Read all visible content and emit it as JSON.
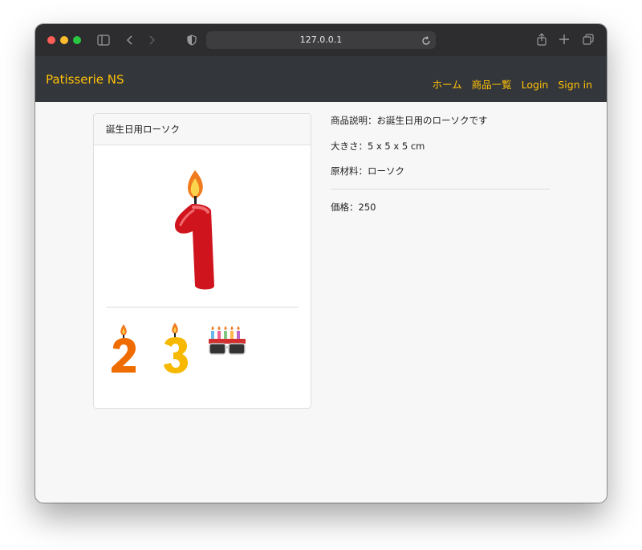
{
  "browser": {
    "url": "127.0.0.1"
  },
  "navbar": {
    "brand": "Patisserie NS",
    "links": [
      "ホーム",
      "商品一覧",
      "Login",
      "Sign in"
    ]
  },
  "product": {
    "name": "誕生日用ローソク",
    "description": "商品説明：お誕生日用のローソクです",
    "size": "大きさ：5 x 5 x 5 cm",
    "material": "原材料：ローソク",
    "price": "価格：250",
    "main_image": "candle-number-1-image",
    "thumbnails": [
      "candle-number-2-image",
      "candle-number-3-image",
      "birthday-glasses-image"
    ]
  },
  "colors": {
    "brand": "#ffc107",
    "navbar": "#33363b"
  }
}
